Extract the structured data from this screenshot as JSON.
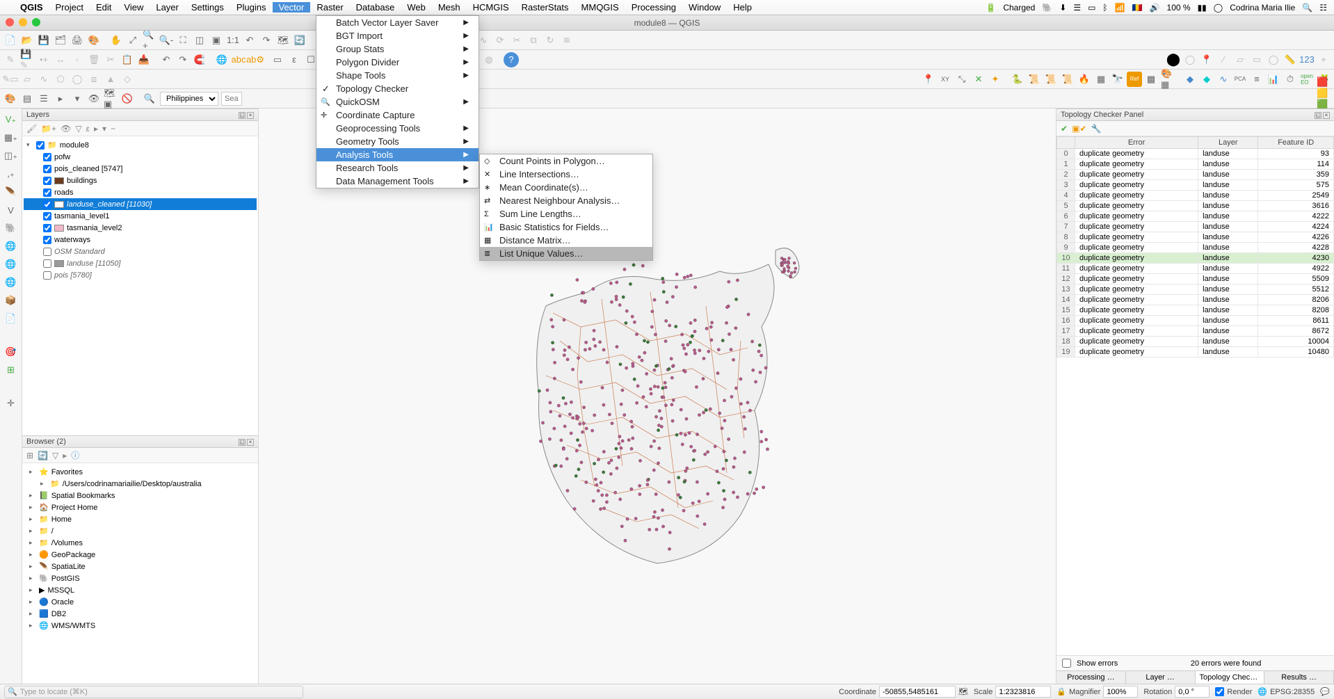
{
  "mac_menu": {
    "app": "QGIS",
    "items": [
      "Project",
      "Edit",
      "View",
      "Layer",
      "Settings",
      "Plugins",
      "Vector",
      "Raster",
      "Database",
      "Web",
      "Mesh",
      "HCMGIS",
      "RasterStats",
      "MMQGIS",
      "Processing",
      "Window",
      "Help"
    ],
    "active": "Vector",
    "status": {
      "battery": "Charged",
      "percent": "100 %",
      "user": "Codrina Maria Ilie"
    }
  },
  "window_title": "module8 — QGIS",
  "vector_menu": {
    "items": [
      {
        "label": "Batch Vector Layer Saver",
        "sub": true
      },
      {
        "label": "BGT Import",
        "sub": true
      },
      {
        "label": "Group Stats",
        "sub": true
      },
      {
        "label": "Polygon Divider",
        "sub": true
      },
      {
        "label": "Shape Tools",
        "sub": true
      },
      {
        "label": "Topology Checker",
        "check": true
      },
      {
        "label": "QuickOSM",
        "sub": true,
        "icon": "🔍"
      },
      {
        "label": "Coordinate Capture",
        "icon": "✛"
      },
      {
        "label": "Geoprocessing Tools",
        "sub": true
      },
      {
        "label": "Geometry Tools",
        "sub": true
      },
      {
        "label": "Analysis Tools",
        "sub": true,
        "hl": true
      },
      {
        "label": "Research Tools",
        "sub": true
      },
      {
        "label": "Data Management Tools",
        "sub": true
      }
    ]
  },
  "analysis_menu": {
    "items": [
      {
        "label": "Count Points in Polygon…",
        "icon": "◇"
      },
      {
        "label": "Line Intersections…",
        "icon": "✕"
      },
      {
        "label": "Mean Coordinate(s)…",
        "icon": "∗"
      },
      {
        "label": "Nearest Neighbour Analysis…",
        "icon": "⇄"
      },
      {
        "label": "Sum Line Lengths…",
        "icon": "Σ"
      },
      {
        "label": "Basic Statistics for Fields…",
        "icon": "📊"
      },
      {
        "label": "Distance Matrix…",
        "icon": "▦"
      },
      {
        "label": "List Unique Values…",
        "icon": "≣",
        "hov": true
      }
    ]
  },
  "locator_combo": "Philippines",
  "search_placeholder": "Sea",
  "layers_panel": {
    "title": "Layers",
    "root": "module8",
    "items": [
      {
        "label": "pofw",
        "checked": true
      },
      {
        "label": "pois_cleaned [5747]",
        "checked": true
      },
      {
        "label": "buildings",
        "checked": true,
        "swatch": "#6b3b1f"
      },
      {
        "label": "roads",
        "checked": true
      },
      {
        "label": "landuse_cleaned [11030]",
        "checked": true,
        "selected": true,
        "swatch": "#ffffff"
      },
      {
        "label": "tasmania_level1",
        "checked": true
      },
      {
        "label": "tasmania_level2",
        "checked": true,
        "swatch": "#f0b8c7"
      },
      {
        "label": "waterways",
        "checked": true
      },
      {
        "label": "OSM Standard",
        "checked": false,
        "italic": true
      },
      {
        "label": "landuse [11050]",
        "checked": false,
        "italic": true,
        "swatch": "#9a9a9a"
      },
      {
        "label": "pois [5780]",
        "checked": false,
        "italic": true
      }
    ]
  },
  "browser_panel": {
    "title": "Browser (2)",
    "items": [
      {
        "label": "Favorites",
        "icon": "⭐"
      },
      {
        "label": "/Users/codrinamariailie/Desktop/australia",
        "icon": "📁",
        "indent": 1
      },
      {
        "label": "Spatial Bookmarks",
        "icon": "📗"
      },
      {
        "label": "Project Home",
        "icon": "🏠"
      },
      {
        "label": "Home",
        "icon": "📁"
      },
      {
        "label": "/",
        "icon": "📁"
      },
      {
        "label": "/Volumes",
        "icon": "📁"
      },
      {
        "label": "GeoPackage",
        "icon": "🟠"
      },
      {
        "label": "SpatiaLite",
        "icon": "🪶"
      },
      {
        "label": "PostGIS",
        "icon": "🐘"
      },
      {
        "label": "MSSQL",
        "icon": "▶"
      },
      {
        "label": "Oracle",
        "icon": "🔵"
      },
      {
        "label": "DB2",
        "icon": "🟦"
      },
      {
        "label": "WMS/WMTS",
        "icon": "🌐"
      }
    ]
  },
  "topo_panel": {
    "title": "Topology Checker Panel",
    "columns": [
      "Error",
      "Layer",
      "Feature ID"
    ],
    "rows": [
      {
        "n": 0,
        "err": "duplicate geometry",
        "layer": "landuse",
        "fid": 93
      },
      {
        "n": 1,
        "err": "duplicate geometry",
        "layer": "landuse",
        "fid": 114
      },
      {
        "n": 2,
        "err": "duplicate geometry",
        "layer": "landuse",
        "fid": 359
      },
      {
        "n": 3,
        "err": "duplicate geometry",
        "layer": "landuse",
        "fid": 575
      },
      {
        "n": 4,
        "err": "duplicate geometry",
        "layer": "landuse",
        "fid": 2549
      },
      {
        "n": 5,
        "err": "duplicate geometry",
        "layer": "landuse",
        "fid": 3616
      },
      {
        "n": 6,
        "err": "duplicate geometry",
        "layer": "landuse",
        "fid": 4222
      },
      {
        "n": 7,
        "err": "duplicate geometry",
        "layer": "landuse",
        "fid": 4224
      },
      {
        "n": 8,
        "err": "duplicate geometry",
        "layer": "landuse",
        "fid": 4226
      },
      {
        "n": 9,
        "err": "duplicate geometry",
        "layer": "landuse",
        "fid": 4228
      },
      {
        "n": 10,
        "err": "duplicate geometry",
        "layer": "landuse",
        "fid": 4230,
        "hl": true
      },
      {
        "n": 11,
        "err": "duplicate geometry",
        "layer": "landuse",
        "fid": 4922
      },
      {
        "n": 12,
        "err": "duplicate geometry",
        "layer": "landuse",
        "fid": 5509
      },
      {
        "n": 13,
        "err": "duplicate geometry",
        "layer": "landuse",
        "fid": 5512
      },
      {
        "n": 14,
        "err": "duplicate geometry",
        "layer": "landuse",
        "fid": 8206
      },
      {
        "n": 15,
        "err": "duplicate geometry",
        "layer": "landuse",
        "fid": 8208
      },
      {
        "n": 16,
        "err": "duplicate geometry",
        "layer": "landuse",
        "fid": 8611
      },
      {
        "n": 17,
        "err": "duplicate geometry",
        "layer": "landuse",
        "fid": 8672
      },
      {
        "n": 18,
        "err": "duplicate geometry",
        "layer": "landuse",
        "fid": 10004
      },
      {
        "n": 19,
        "err": "duplicate geometry",
        "layer": "landuse",
        "fid": 10480
      }
    ],
    "show_errors": "Show errors",
    "found": "20 errors were found",
    "tabs": [
      "Processing …",
      "Layer …",
      "Topology Checke…",
      "Results …"
    ],
    "active_tab": 2
  },
  "statusbar": {
    "locator_placeholder": "Type to locate (⌘K)",
    "coord_label": "Coordinate",
    "coord_val": "-50855,5485161",
    "scale_label": "Scale",
    "scale_val": "1:2323816",
    "mag_label": "Magnifier",
    "mag_val": "100%",
    "rot_label": "Rotation",
    "rot_val": "0,0 °",
    "render": "Render",
    "crs": "EPSG:28355"
  }
}
